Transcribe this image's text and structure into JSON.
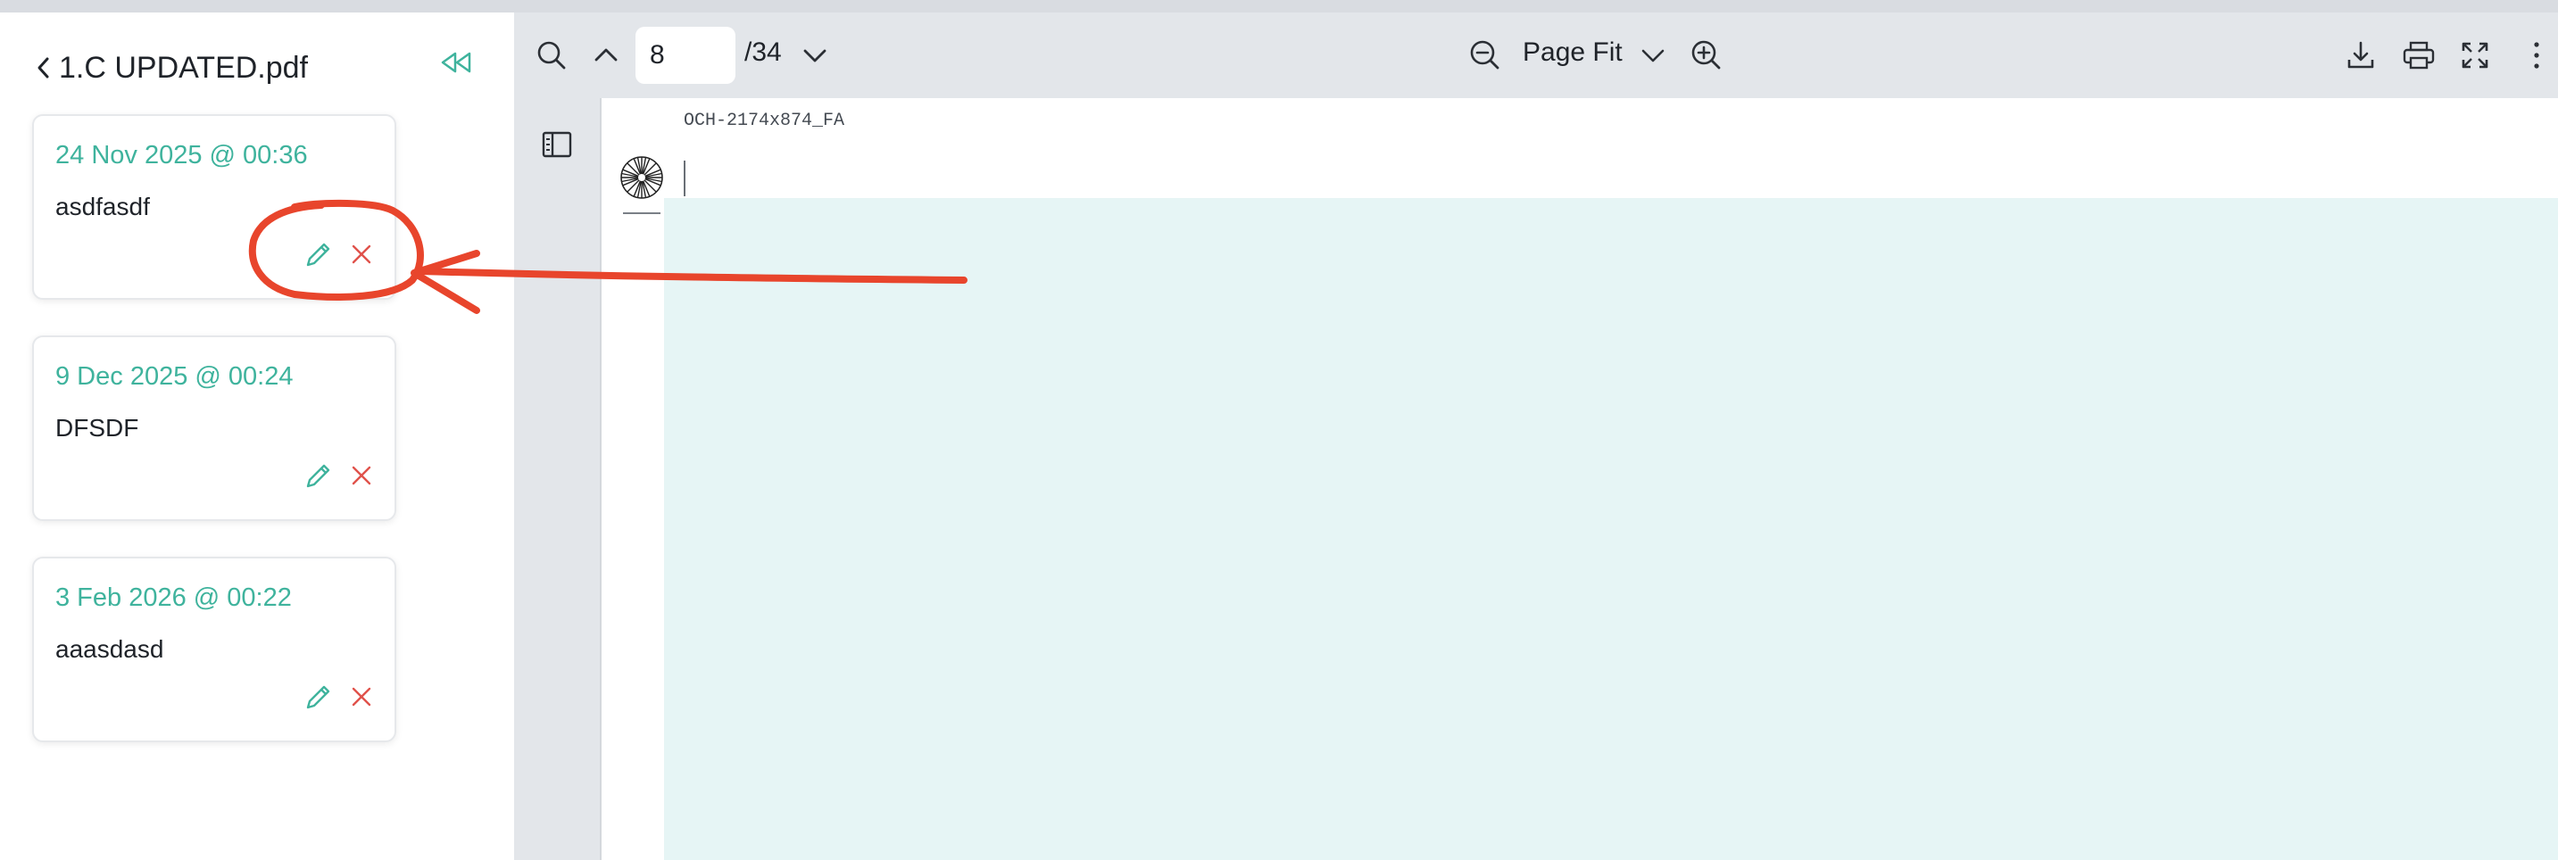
{
  "sidebar": {
    "title": "1.C UPDATED.pdf",
    "notes": [
      {
        "date": "24 Nov 2025 @ 00:36",
        "text": "asdfasdf"
      },
      {
        "date": "9 Dec 2025 @ 00:24",
        "text": "DFSDF"
      },
      {
        "date": "3 Feb 2026 @ 00:22",
        "text": "aaasdasd"
      }
    ]
  },
  "toolbar": {
    "page_current": "8",
    "page_total": "/34",
    "zoom_label": "Page Fit"
  },
  "document": {
    "header_text": "OCH-2174x874_FA"
  },
  "colors": {
    "accent": "#3fb39d",
    "delete": "#e0524b",
    "annotation": "#e8452c",
    "toolbar_bg": "#e3e6ea",
    "page_tint": "#e6f5f5"
  },
  "icons": [
    "chevron-left-icon",
    "rewind-icon",
    "search-icon",
    "chevron-up-icon",
    "chevron-down-icon",
    "zoom-out-icon",
    "zoom-in-icon",
    "download-icon",
    "print-icon",
    "fullscreen-icon",
    "more-vertical-icon",
    "sidebar-panel-icon",
    "pencil-icon",
    "close-icon"
  ]
}
